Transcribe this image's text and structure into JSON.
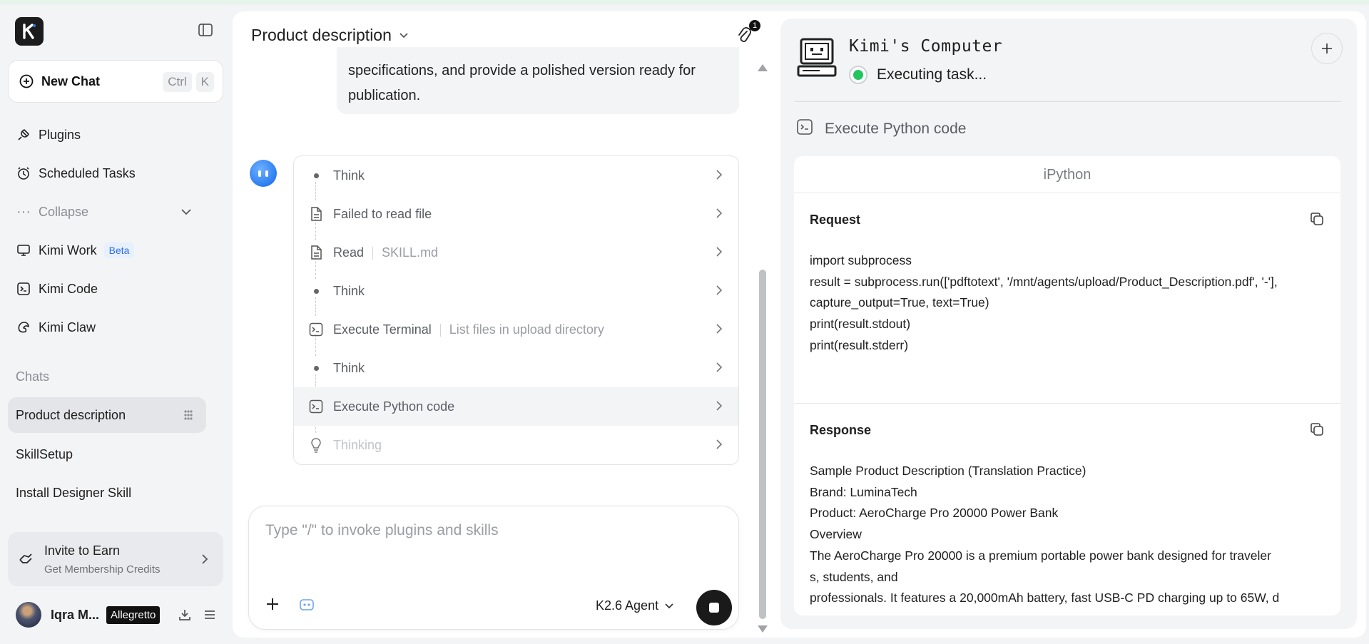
{
  "sidebar": {
    "new_chat": "New Chat",
    "shortcut_ctrl": "Ctrl",
    "shortcut_key": "K",
    "nav": {
      "plugins": "Plugins",
      "scheduled": "Scheduled Tasks",
      "collapse": "Collapse",
      "kimi_work": "Kimi Work",
      "beta": "Beta",
      "kimi_code": "Kimi Code",
      "kimi_claw": "Kimi Claw"
    },
    "chats_label": "Chats",
    "chats": [
      "Product description",
      "SkillSetup",
      "Install Designer Skill"
    ],
    "invite_title": "Invite to Earn",
    "invite_sub": "Get Membership Credits",
    "user_name": "Iqra M...",
    "user_plan": "Allegretto"
  },
  "chat": {
    "title": "Product description",
    "attachment_count": "1",
    "user_message_line1": "specifications, and provide a polished version ready for",
    "user_message_line2": "publication.",
    "steps": [
      {
        "label": "Think",
        "sub": ""
      },
      {
        "label": "Failed to read file",
        "sub": ""
      },
      {
        "label": "Read",
        "sub": "SKILL.md"
      },
      {
        "label": "Think",
        "sub": ""
      },
      {
        "label": "Execute Terminal",
        "sub": "List files in upload directory"
      },
      {
        "label": "Think",
        "sub": ""
      },
      {
        "label": "Execute Python code",
        "sub": ""
      },
      {
        "label": "Thinking",
        "sub": ""
      }
    ],
    "input_placeholder": "Type \"/\" to invoke plugins and skills",
    "model": "K2.6 Agent"
  },
  "computer": {
    "title": "Kimi's Computer",
    "status": "Executing task...",
    "tool": "Execute Python code",
    "panel_title": "iPython",
    "request_label": "Request",
    "request_code": "import subprocess\nresult = subprocess.run(['pdftotext', '/mnt/agents/upload/Product_Description.pdf', '-'],\ncapture_output=True, text=True)\nprint(result.stdout)\nprint(result.stderr)",
    "response_label": "Response",
    "response_text": "Sample Product Description (Translation Practice)\nBrand: LuminaTech\nProduct: AeroCharge Pro 20000 Power Bank\nOverview\nThe AeroCharge Pro 20000 is a premium portable power bank designed for traveler\ns, students, and\nprofessionals. It features a 20,000mAh battery, fast USB-C PD charging up to 65W, d"
  },
  "colors": {
    "accent_blue": "#2b7cf0",
    "status_green": "#22c55e",
    "background": "#f3f4f6"
  }
}
